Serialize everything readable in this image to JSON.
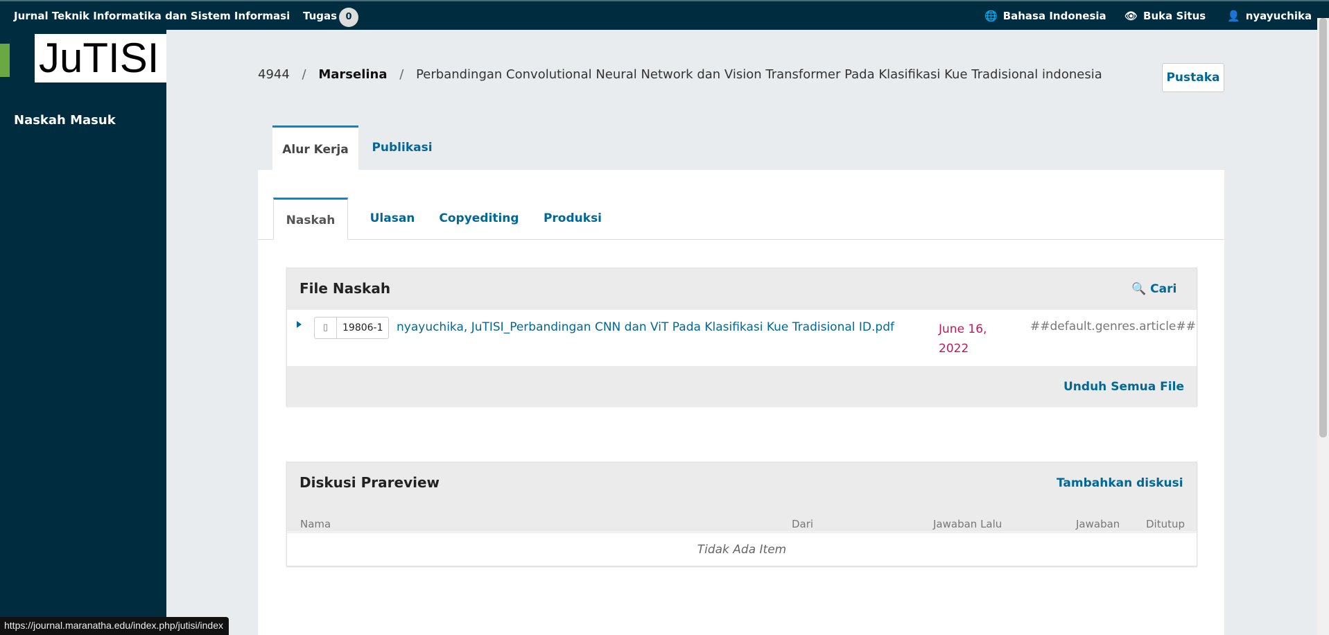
{
  "topbar": {
    "site_title": "Jurnal Teknik Informatika dan Sistem Informasi",
    "tasks_label": "Tugas",
    "tasks_count": "0",
    "language_label": "Bahasa Indonesia",
    "view_site_label": "Buka Situs",
    "username": "nyayuchika"
  },
  "sidebar": {
    "logo_text": "JuTISI",
    "nav_submissions": "Naskah Masuk"
  },
  "breadcrumb": {
    "id": "4944",
    "separator": "/",
    "author": "Marselina",
    "title": "Perbandingan Convolutional Neural Network dan Vision Transformer Pada Klasifikasi Kue Tradisional indonesia"
  },
  "library_button": "Pustaka",
  "main_tabs": [
    {
      "label": "Alur Kerja"
    },
    {
      "label": "Publikasi"
    }
  ],
  "stage_tabs": [
    {
      "label": "Naskah"
    },
    {
      "label": "Ulasan"
    },
    {
      "label": "Copyediting"
    },
    {
      "label": "Produksi"
    }
  ],
  "files_grid": {
    "title": "File Naskah",
    "search_label": "Cari",
    "rows": [
      {
        "id": "19806-1",
        "name": "nyayuchika, JuTISI_Perbandingan CNN dan ViT Pada Klasifikasi Kue Tradisional ID.pdf",
        "date_line1": "June 16,",
        "date_line2": "2022",
        "genre": "##default.genres.article##"
      }
    ],
    "download_all_label": "Unduh Semua File"
  },
  "discussion_grid": {
    "title": "Diskusi Prareview",
    "add_label": "Tambahkan diskusi",
    "columns": [
      "Nama",
      "Dari",
      "Jawaban Lalu",
      "Jawaban",
      "Ditutup"
    ],
    "empty_text": "Tidak Ada Item"
  },
  "status_url": "https://journal.maranatha.edu/index.php/jutisi/index",
  "colors": {
    "primary": "#002c40",
    "link": "#006798",
    "accent_tab": "#008acb",
    "date": "#c2185b",
    "logo_bar": "#6aa843"
  }
}
